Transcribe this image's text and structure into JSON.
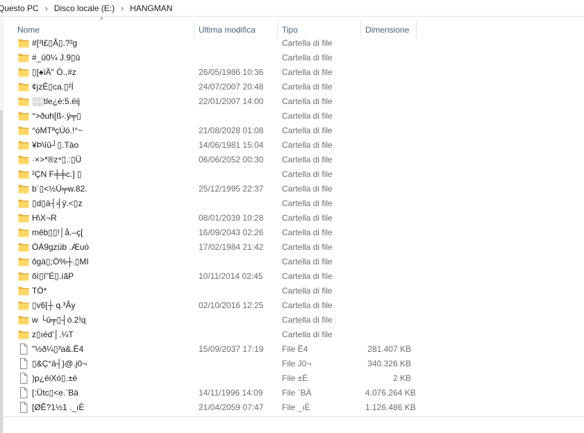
{
  "breadcrumb": [
    "Questo PC",
    "Disco locale (E:)",
    "HANGMAN"
  ],
  "columns": {
    "name": "Nome",
    "modified": "Ultima modifica",
    "type": "Tipo",
    "size": "Dimensione"
  },
  "sort_indicator": "^",
  "items": [
    {
      "icon": "folder-icon",
      "name": "#[³l£▯Â▯.?²g",
      "modified": "",
      "type": "Cartella di file",
      "size": ""
    },
    {
      "icon": "folder-icon",
      "name": "#_û0¼  J.9▯û",
      "modified": "",
      "type": "Cartella di file",
      "size": ""
    },
    {
      "icon": "folder-icon",
      "name": "▯[♠ïÄ\" Ò.,#z",
      "modified": "26/05/1986 10:36",
      "type": "Cartella di file",
      "size": ""
    },
    {
      "icon": "folder-icon",
      "name": "¢jzÊ▯ca.▯²Í",
      "modified": "24/07/2007 20:48",
      "type": "Cartella di file",
      "size": ""
    },
    {
      "icon": "folder-icon",
      "name": "░░tle¿è:5.ëij",
      "modified": "22/01/2007 14:00",
      "type": "Cartella di file",
      "size": ""
    },
    {
      "icon": "folder-icon",
      "name": "°>ðuh[ß-.ÿ╤▯",
      "modified": "",
      "type": "Cartella di file",
      "size": ""
    },
    {
      "icon": "folder-icon",
      "name": "°óMTªçÚó.!°~",
      "modified": "21/08/2028 01:08",
      "type": "Cartella di file",
      "size": ""
    },
    {
      "icon": "folder-icon",
      "name": "¥Þ\\îû┘▯.Tào",
      "modified": "14/06/1981 15:04",
      "type": "Cartella di file",
      "size": ""
    },
    {
      "icon": "folder-icon",
      "name": "·×>*®z⁴▯.:▯Ü",
      "modified": "06/06/2052 00:30",
      "type": "Cartella di file",
      "size": ""
    },
    {
      "icon": "folder-icon",
      "name": "²ÇN  F╪╪c.] ▯",
      "modified": "",
      "type": "Cartella di file",
      "size": ""
    },
    {
      "icon": "folder-icon",
      "name": "b´▯<½Ù╤w.82.",
      "modified": "25/12/1995 22:37",
      "type": "Cartella di file",
      "size": ""
    },
    {
      "icon": "folder-icon",
      "name": "▯d▯ä┤╡ÿ.<▯z",
      "modified": "",
      "type": "Cartella di file",
      "size": ""
    },
    {
      "icon": "folder-icon",
      "name": "H\\X¬R",
      "modified": "08/01/2039 10:28",
      "type": "Cartella di file",
      "size": ""
    },
    {
      "icon": "folder-icon",
      "name": "mêb▯▯!│å.–ç[",
      "modified": "16/09/2043 02:26",
      "type": "Cartella di file",
      "size": ""
    },
    {
      "icon": "folder-icon",
      "name": "ÓÁ9gzüb .Æuó",
      "modified": "17/02/1984 21:42",
      "type": "Cartella di file",
      "size": ""
    },
    {
      "icon": "folder-icon",
      "name": "ôgà▯;Ò%┼.▯MI",
      "modified": "",
      "type": "Cartella di file",
      "size": ""
    },
    {
      "icon": "folder-icon",
      "name": "õí▯î\"É▯.íãP",
      "modified": "10/11/2014 02:45",
      "type": "Cartella di file",
      "size": ""
    },
    {
      "icon": "folder-icon",
      "name": "TÖ*",
      "modified": "",
      "type": "Cartella di file",
      "size": ""
    },
    {
      "icon": "folder-icon",
      "name": "▯v6[┼ q.³Ây",
      "modified": "02/10/2016 12:25",
      "type": "Cartella di file",
      "size": ""
    },
    {
      "icon": "folder-icon",
      "name": "w └û╤▯┤ó.2!q",
      "modified": "",
      "type": "Cartella di file",
      "size": ""
    },
    {
      "icon": "folder-icon",
      "name": "z▯ıéd'│.¼T",
      "modified": "",
      "type": "Cartella di file",
      "size": ""
    },
    {
      "icon": "file-icon",
      "name": "\"½ð¼▯³a&.Ë4",
      "modified": "15/09/2037 17:19",
      "type": "File Ë4",
      "size": "281.407 KB"
    },
    {
      "icon": "file-icon",
      "name": "▯&Ç°ä┤}@.j0¬",
      "modified": "",
      "type": "File J0¬",
      "size": "340.326 KB"
    },
    {
      "icon": "file-icon",
      "name": ")p¿ëiXó▯.±é",
      "modified": "",
      "type": "File ±É",
      "size": "2 KB"
    },
    {
      "icon": "file-icon",
      "name": "[:Ütc▯<e.¨Bà",
      "modified": "14/11/1996 14:09",
      "type": "File ¨BÀ",
      "size": "4.076.264 KB"
    },
    {
      "icon": "file-icon",
      "name": "[ØÊ?1½1 ._ıÈ",
      "modified": "21/04/2059 07:47",
      "type": "File _ıÈ",
      "size": "1.126.486 KB"
    }
  ]
}
